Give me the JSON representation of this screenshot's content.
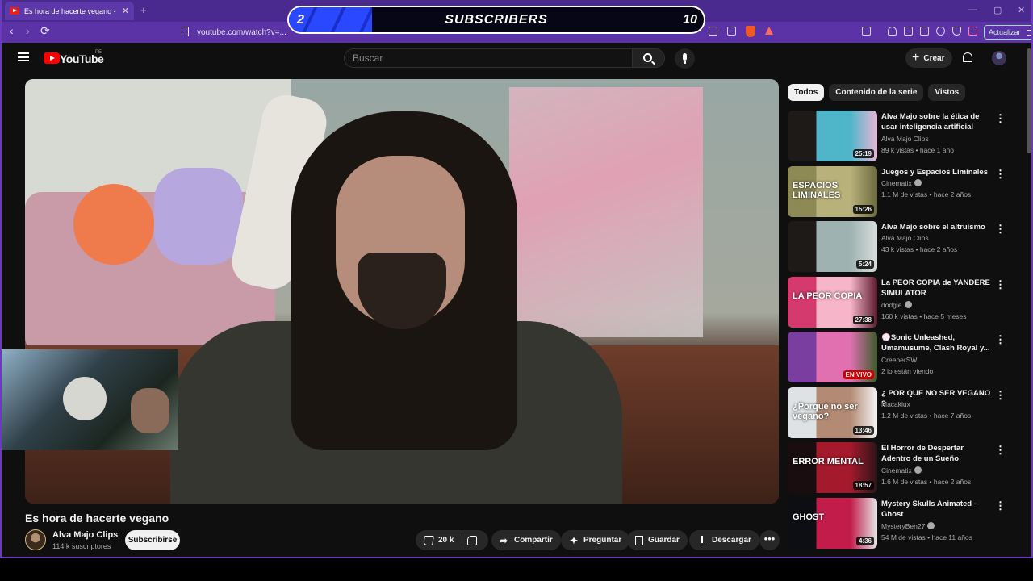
{
  "browser": {
    "tab_title": "Es hora de hacerte vegano - You",
    "tab_close": "✕",
    "new_tab": "+",
    "url": "youtube.com/watch?v=...",
    "update_label": "Actualizar",
    "back": "‹",
    "forward": "›",
    "reload": "⟳"
  },
  "overlay": {
    "left_value": "2",
    "label": "SUBSCRIBERS",
    "right_value": "10",
    "progress_fraction": 0.2
  },
  "youtube": {
    "logo_text": "YouTube",
    "region": "PE",
    "search_placeholder": "Buscar",
    "create_label": "Crear",
    "video": {
      "title": "Es hora de hacerte vegano",
      "channel": "Alva Majo Clips",
      "subscribers": "114 k suscriptores",
      "subscribe_label": "Subscribirse",
      "likes": "20 k",
      "share_label": "Compartir",
      "ask_label": "Preguntar",
      "save_label": "Guardar",
      "download_label": "Descargar",
      "more": "•••"
    },
    "chips": [
      {
        "label": "Todos",
        "active": true
      },
      {
        "label": "Contenido de la serie",
        "active": false
      },
      {
        "label": "Vistos",
        "active": false
      }
    ],
    "recommendations": [
      {
        "title": "Alva Majo sobre la ética de usar inteligencia artificial",
        "channel": "Alva Majo Clips",
        "meta": "89 k vistas • hace 1 año",
        "duration": "25:19",
        "verified": false,
        "colors": [
          "#1e1a17",
          "#4fb6c9",
          "#e9b6d6"
        ]
      },
      {
        "title": "Juegos y Espacios Liminales",
        "channel": "Cinematix",
        "meta": "1.1 M de vistas • hace 2 años",
        "duration": "15:26",
        "verified": true,
        "thumb_text": "ESPACIOS LIMINALES",
        "colors": [
          "#8d8a55",
          "#b8b17a",
          "#6c6a3f"
        ]
      },
      {
        "title": "Alva Majo sobre el altruismo",
        "channel": "Alva Majo Clips",
        "meta": "43 k vistas • hace 2 años",
        "duration": "5:24",
        "verified": false,
        "colors": [
          "#1e1a17",
          "#9eb3b1",
          "#d9dedd"
        ]
      },
      {
        "title": "La PEOR COPIA de YANDERE SIMULATOR",
        "channel": "dodgie",
        "meta": "160 k vistas • hace 5 meses",
        "duration": "27:38",
        "verified": true,
        "thumb_text": "LA PEOR COPIA",
        "colors": [
          "#d43a6e",
          "#f6b5c9",
          "#5b1a2e"
        ]
      },
      {
        "title": "💮Sonic Unleashed, Umamusume, Clash Royal y...",
        "channel": "CreeperSW",
        "meta": "2 lo están viendo",
        "duration": "EN VIVO",
        "live": true,
        "verified": false,
        "colors": [
          "#7a3ea0",
          "#e070b0",
          "#3d5a2a"
        ]
      },
      {
        "title": "¿ POR QUE NO SER VEGANO ?",
        "channel": "Macakiux",
        "meta": "1.2 M de vistas • hace 7 años",
        "duration": "13:46",
        "verified": false,
        "thumb_text": "¿Porqué no ser vegano?",
        "colors": [
          "#dfe2e4",
          "#b38b74",
          "#f5f5f5"
        ]
      },
      {
        "title": "El Horror de Despertar Adentro de un Sueño",
        "channel": "Cinematix",
        "meta": "1.6 M de vistas • hace 2 años",
        "duration": "18:57",
        "verified": true,
        "thumb_text": "ERROR MENTAL",
        "colors": [
          "#1a0d0f",
          "#a4192b",
          "#2b1518"
        ]
      },
      {
        "title": "Mystery Skulls Animated - Ghost",
        "channel": "MysteryBen27",
        "meta": "54 M de vistas • hace 11 años",
        "duration": "4:36",
        "verified": true,
        "thumb_text": "GHOST",
        "colors": [
          "#0d0d14",
          "#c21c4b",
          "#e5e5e5"
        ]
      }
    ]
  }
}
